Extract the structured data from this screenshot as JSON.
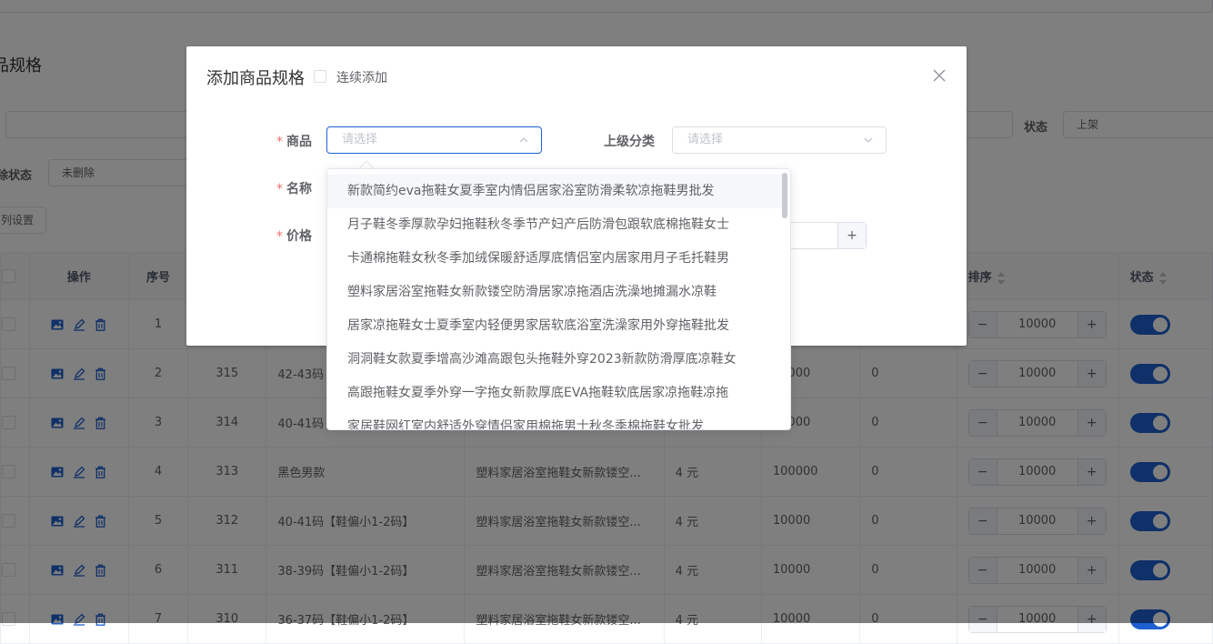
{
  "page": {
    "title": "品规格",
    "filter_delete_label": "除状态",
    "filter_delete_value": "未删除",
    "filter_status_label": "状态",
    "filter_status_value": "上架",
    "col_settings": "列设置"
  },
  "table": {
    "headers": [
      "操作",
      "序号",
      "排序",
      "状态"
    ],
    "rows": [
      {
        "index": "1",
        "id": "",
        "name": "",
        "product": "",
        "price": "",
        "stock": "",
        "sold": "",
        "sort": "10000"
      },
      {
        "index": "2",
        "id": "315",
        "name": "42-43码",
        "product": "",
        "price": "",
        "stock": "10000",
        "sold": "0",
        "sort": "10000"
      },
      {
        "index": "3",
        "id": "314",
        "name": "40-41码",
        "product": "",
        "price": "",
        "stock": "10000",
        "sold": "0",
        "sort": "10000"
      },
      {
        "index": "4",
        "id": "313",
        "name": "黑色男款",
        "product": "塑料家居浴室拖鞋女新款镂空...",
        "price": "4 元",
        "stock": "100000",
        "sold": "0",
        "sort": "10000"
      },
      {
        "index": "5",
        "id": "312",
        "name": "40-41码【鞋偏小1-2码】",
        "product": "塑料家居浴室拖鞋女新款镂空...",
        "price": "4 元",
        "stock": "10000",
        "sold": "0",
        "sort": "10000"
      },
      {
        "index": "6",
        "id": "311",
        "name": "38-39码【鞋偏小1-2码】",
        "product": "塑料家居浴室拖鞋女新款镂空...",
        "price": "4 元",
        "stock": "10000",
        "sold": "0",
        "sort": "10000"
      },
      {
        "index": "7",
        "id": "310",
        "name": "36-37码【鞋偏小1-2码】",
        "product": "塑料家居浴室拖鞋女新款镂空...",
        "price": "4 元",
        "stock": "10000",
        "sold": "0",
        "sort": "10000"
      }
    ]
  },
  "dialog": {
    "title": "添加商品规格",
    "continuous_add_label": "连续添加",
    "field_product_label": "商品",
    "field_product_placeholder": "请选择",
    "field_parent_label": "上级分类",
    "field_parent_placeholder": "请选择",
    "field_name_label": "名称",
    "field_price_label": "价格",
    "plus": "+"
  },
  "dropdown": {
    "options": [
      "新款简约eva拖鞋女夏季室内情侣居家浴室防滑柔软凉拖鞋男批发",
      "月子鞋冬季厚款孕妇拖鞋秋冬季节产妇产后防滑包跟软底棉拖鞋女士",
      "卡通棉拖鞋女秋冬季加绒保暖舒适厚底情侣室内居家用月子毛托鞋男",
      "塑料家居浴室拖鞋女新款镂空防滑居家凉拖酒店洗澡地摊漏水凉鞋",
      "居家凉拖鞋女士夏季室内轻便男家居软底浴室洗澡家用外穿拖鞋批发",
      "洞洞鞋女款夏季增高沙滩高跟包头拖鞋外穿2023新款防滑厚底凉鞋女",
      "高跟拖鞋女夏季外穿一字拖女新款厚底EVA拖鞋软底居家凉拖鞋凉拖",
      "家居鞋网红室内舒适外穿情侣家用棉拖男士秋冬季棉拖鞋女批发"
    ]
  },
  "colors": {
    "primary": "#1e60d1",
    "required": "#f56c6c",
    "overlay": "rgba(0,0,0,0.5)"
  }
}
